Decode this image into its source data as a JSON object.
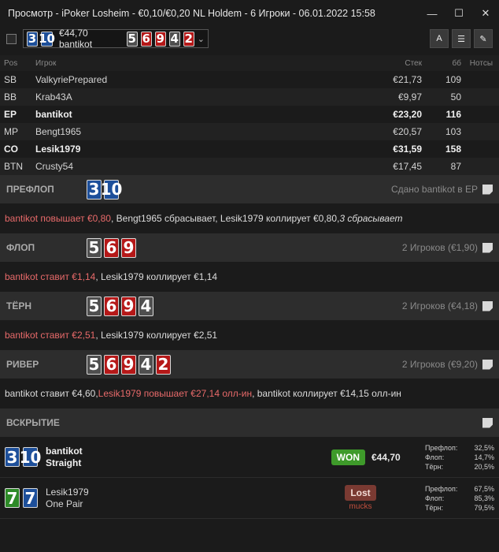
{
  "window": {
    "title": "Просмотр - iPoker Losheim - €0,10/€0,20 NL Holdem - 6 Игроки - 06.01.2022 15:58",
    "minimize": "—",
    "maximize": "☐",
    "close": "✕"
  },
  "toolbar": {
    "hand_cards": [
      "3",
      "10"
    ],
    "hand_label": "€44,70 bantikot",
    "board_cards": [
      "5",
      "6",
      "9",
      "4",
      "2"
    ],
    "chevron": "⌄",
    "btn_font": "A",
    "btn_list": "☰",
    "btn_edit": "✎"
  },
  "players": {
    "headers": {
      "pos": "Pos",
      "name": "Игрок",
      "stack": "Стек",
      "bb": "бб",
      "notes": "Нотсы"
    },
    "rows": [
      {
        "pos": "SB",
        "name": "ValkyriePrepared",
        "stack": "€21,73",
        "bb": "109",
        "bold": false
      },
      {
        "pos": "BB",
        "name": "Krab43A",
        "stack": "€9,97",
        "bb": "50",
        "bold": false
      },
      {
        "pos": "EP",
        "name": "bantikot",
        "stack": "€23,20",
        "bb": "116",
        "bold": true
      },
      {
        "pos": "MP",
        "name": "Bengt1965",
        "stack": "€20,57",
        "bb": "103",
        "bold": false
      },
      {
        "pos": "CO",
        "name": "Lesik1979",
        "stack": "€31,59",
        "bb": "158",
        "bold": true
      },
      {
        "pos": "BTN",
        "name": "Crusty54",
        "stack": "€17,45",
        "bb": "87",
        "bold": false
      }
    ]
  },
  "streets": {
    "preflop": {
      "name": "ПРЕФЛОП",
      "info": "Сдано bantikot в EP",
      "actions": {
        "a1": "bantikot повышает €0,80",
        "a2": ", Bengt1965 сбрасывает, Lesik1979 коллирует €0,80, ",
        "a3": "3 сбрасывает"
      }
    },
    "flop": {
      "name": "ФЛОП",
      "info": "2 Игроков (€1,90)",
      "actions": {
        "a1": "bantikot ставит €1,14",
        "a2": ", Lesik1979 коллирует €1,14"
      }
    },
    "turn": {
      "name": "ТЁРН",
      "info": "2 Игроков (€4,18)",
      "actions": {
        "a1": "bantikot ставит €2,51",
        "a2": ", Lesik1979 коллирует €2,51"
      }
    },
    "river": {
      "name": "РИВЕР",
      "info": "2 Игроков (€9,20)",
      "actions": {
        "a1": "bantikot ставит €4,60, ",
        "a2": "Lesik1979 повышает €27,14 олл-ин",
        "a3": ", bantikot коллирует €14,15 олл-ин"
      }
    },
    "showdown": {
      "name": "ВСКРЫТИЕ"
    }
  },
  "showdown": {
    "p1": {
      "cards": [
        "3",
        "10"
      ],
      "name": "bantikot",
      "hand": "Straight",
      "badge": "WON",
      "amount": "€44,70",
      "eq": [
        {
          "label": "Префлоп:",
          "value": "32,5%"
        },
        {
          "label": "Флоп:",
          "value": "14,7%"
        },
        {
          "label": "Тёрн:",
          "value": "20,5%"
        }
      ]
    },
    "p2": {
      "cards": [
        "7",
        "7"
      ],
      "name": "Lesik1979",
      "hand": "One Pair",
      "badge": "Lost",
      "muck": "mucks",
      "eq": [
        {
          "label": "Префлоп:",
          "value": "67,5%"
        },
        {
          "label": "Флоп:",
          "value": "85,3%"
        },
        {
          "label": "Тёрн:",
          "value": "79,5%"
        }
      ]
    }
  },
  "colors": {
    "blue_card": "#1d4f9a",
    "red_card": "#b51818",
    "gray_card": "#4f4f4f",
    "green_card": "#2e8a28",
    "won": "#3e9a2a",
    "lost": "#7a3a32"
  }
}
